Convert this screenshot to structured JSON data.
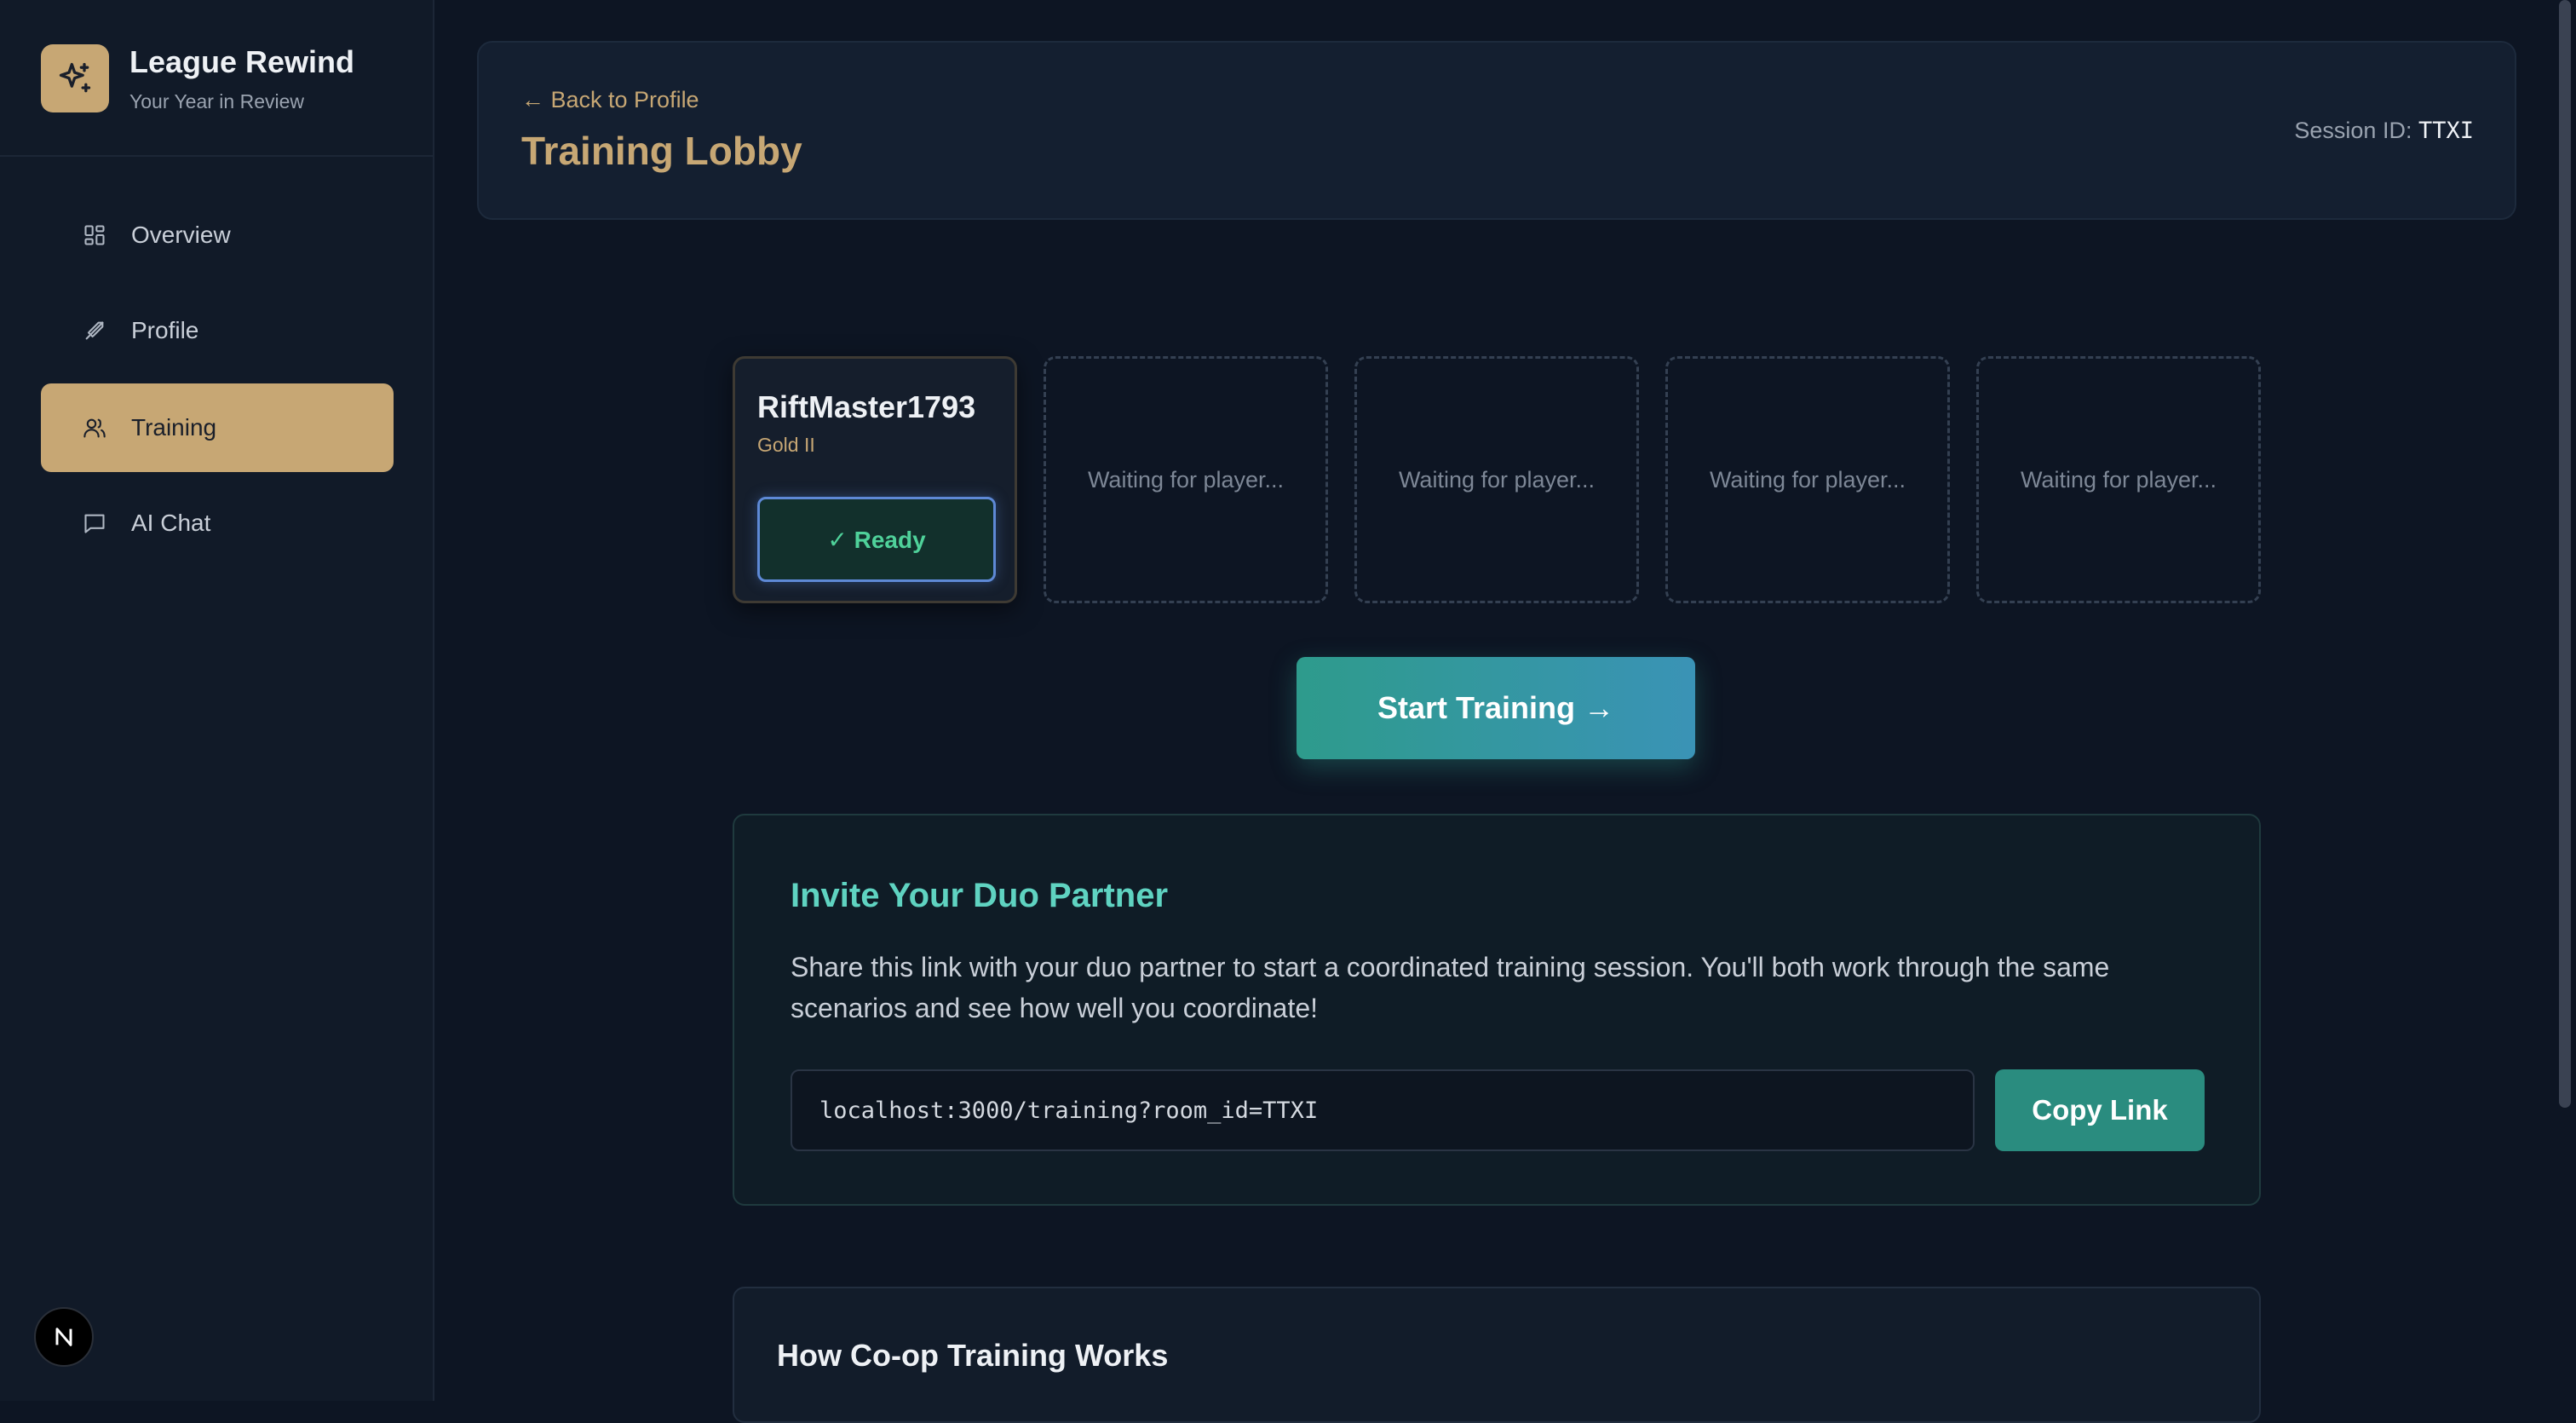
{
  "sidebar": {
    "app_name": "League Rewind",
    "tagline": "Your Year in Review",
    "logo_icon": "sparkles-icon",
    "items": [
      {
        "label": "Overview",
        "icon": "grid-icon",
        "active": false
      },
      {
        "label": "Profile",
        "icon": "sword-icon",
        "active": false
      },
      {
        "label": "Training",
        "icon": "users-icon",
        "active": true
      },
      {
        "label": "AI Chat",
        "icon": "chat-icon",
        "active": false
      }
    ],
    "footer_badge": "N"
  },
  "header": {
    "back_link": "← Back to Profile",
    "title": "Training Lobby",
    "session_label": "Session ID:",
    "session_id": "TTXI"
  },
  "lobby": {
    "player": {
      "name": "RiftMaster1793",
      "rank": "Gold II",
      "status": "✓ Ready"
    },
    "empty_slots": [
      "Waiting for player...",
      "Waiting for player...",
      "Waiting for player...",
      "Waiting for player..."
    ],
    "start_button": "Start Training →"
  },
  "invite": {
    "title": "Invite Your Duo Partner",
    "description": "Share this link with your duo partner to start a coordinated training session. You'll both work through the same scenarios and see how well you coordinate!",
    "link": "localhost:3000/training?room_id=TTXI",
    "copy_button": "Copy Link"
  },
  "how_it_works": {
    "title": "How Co-op Training Works"
  },
  "colors": {
    "accent_gold": "#c7a774",
    "accent_teal": "#5fd3c1",
    "ready_green": "#4fd19a",
    "background": "#0d1523"
  }
}
